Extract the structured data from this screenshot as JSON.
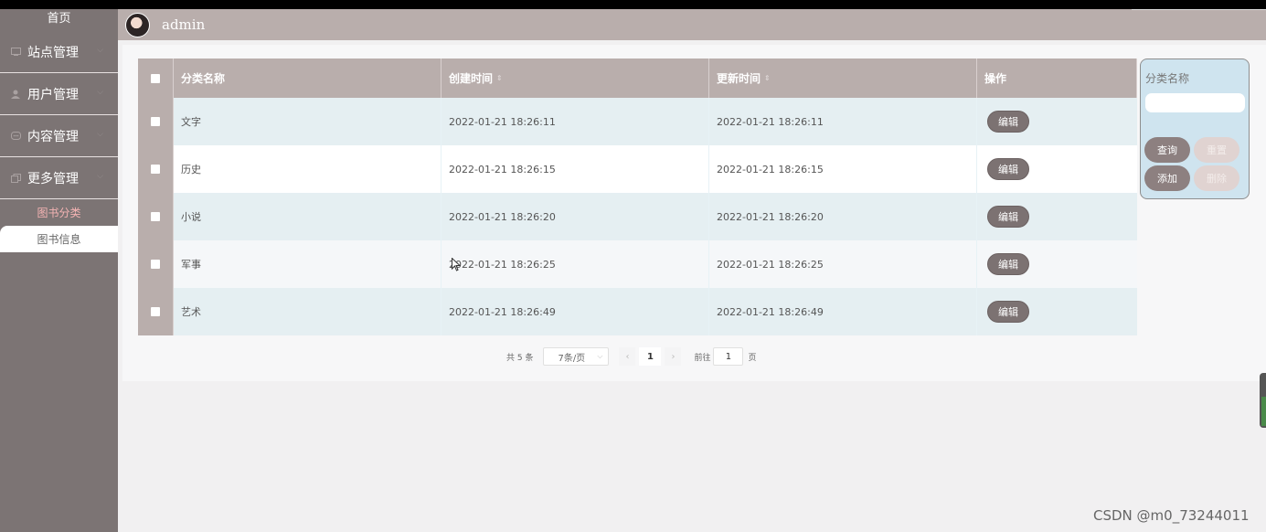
{
  "sidebar": {
    "home": "首页",
    "menus": [
      {
        "label": "站点管理",
        "icon": "monitor-icon"
      },
      {
        "label": "用户管理",
        "icon": "user-icon"
      },
      {
        "label": "内容管理",
        "icon": "message-icon"
      },
      {
        "label": "更多管理",
        "icon": "copy-icon"
      }
    ],
    "sub_items": [
      {
        "label": "图书分类",
        "active": true
      },
      {
        "label": "图书信息",
        "active": false
      }
    ]
  },
  "header": {
    "username": "admin"
  },
  "table": {
    "columns": [
      "分类名称",
      "创建时间",
      "更新时间",
      "操作"
    ],
    "rows": [
      {
        "name": "文字",
        "created": "2022-01-21 18:26:11",
        "updated": "2022-01-21 18:26:11",
        "action": "编辑"
      },
      {
        "name": "历史",
        "created": "2022-01-21 18:26:15",
        "updated": "2022-01-21 18:26:15",
        "action": "编辑"
      },
      {
        "name": "小说",
        "created": "2022-01-21 18:26:20",
        "updated": "2022-01-21 18:26:20",
        "action": "编辑"
      },
      {
        "name": "军事",
        "created": "2022-01-21 18:26:25",
        "updated": "2022-01-21 18:26:25",
        "action": "编辑"
      },
      {
        "name": "艺术",
        "created": "2022-01-21 18:26:49",
        "updated": "2022-01-21 18:26:49",
        "action": "编辑"
      }
    ]
  },
  "pagination": {
    "total": "共 5 条",
    "page_size": "7条/页",
    "current_page": "1",
    "goto_prefix": "前往",
    "goto_value": "1",
    "goto_suffix": "页"
  },
  "search_panel": {
    "label": "分类名称",
    "input_value": "",
    "query": "查询",
    "reset": "重置",
    "add": "添加",
    "delete": "删除"
  },
  "watermark": "CSDN @m0_73244011",
  "colors": {
    "sidebar": "#7c7474",
    "header": "#b9aeac",
    "edit_button": "#7c7272",
    "panel": "#cfe4ef"
  }
}
